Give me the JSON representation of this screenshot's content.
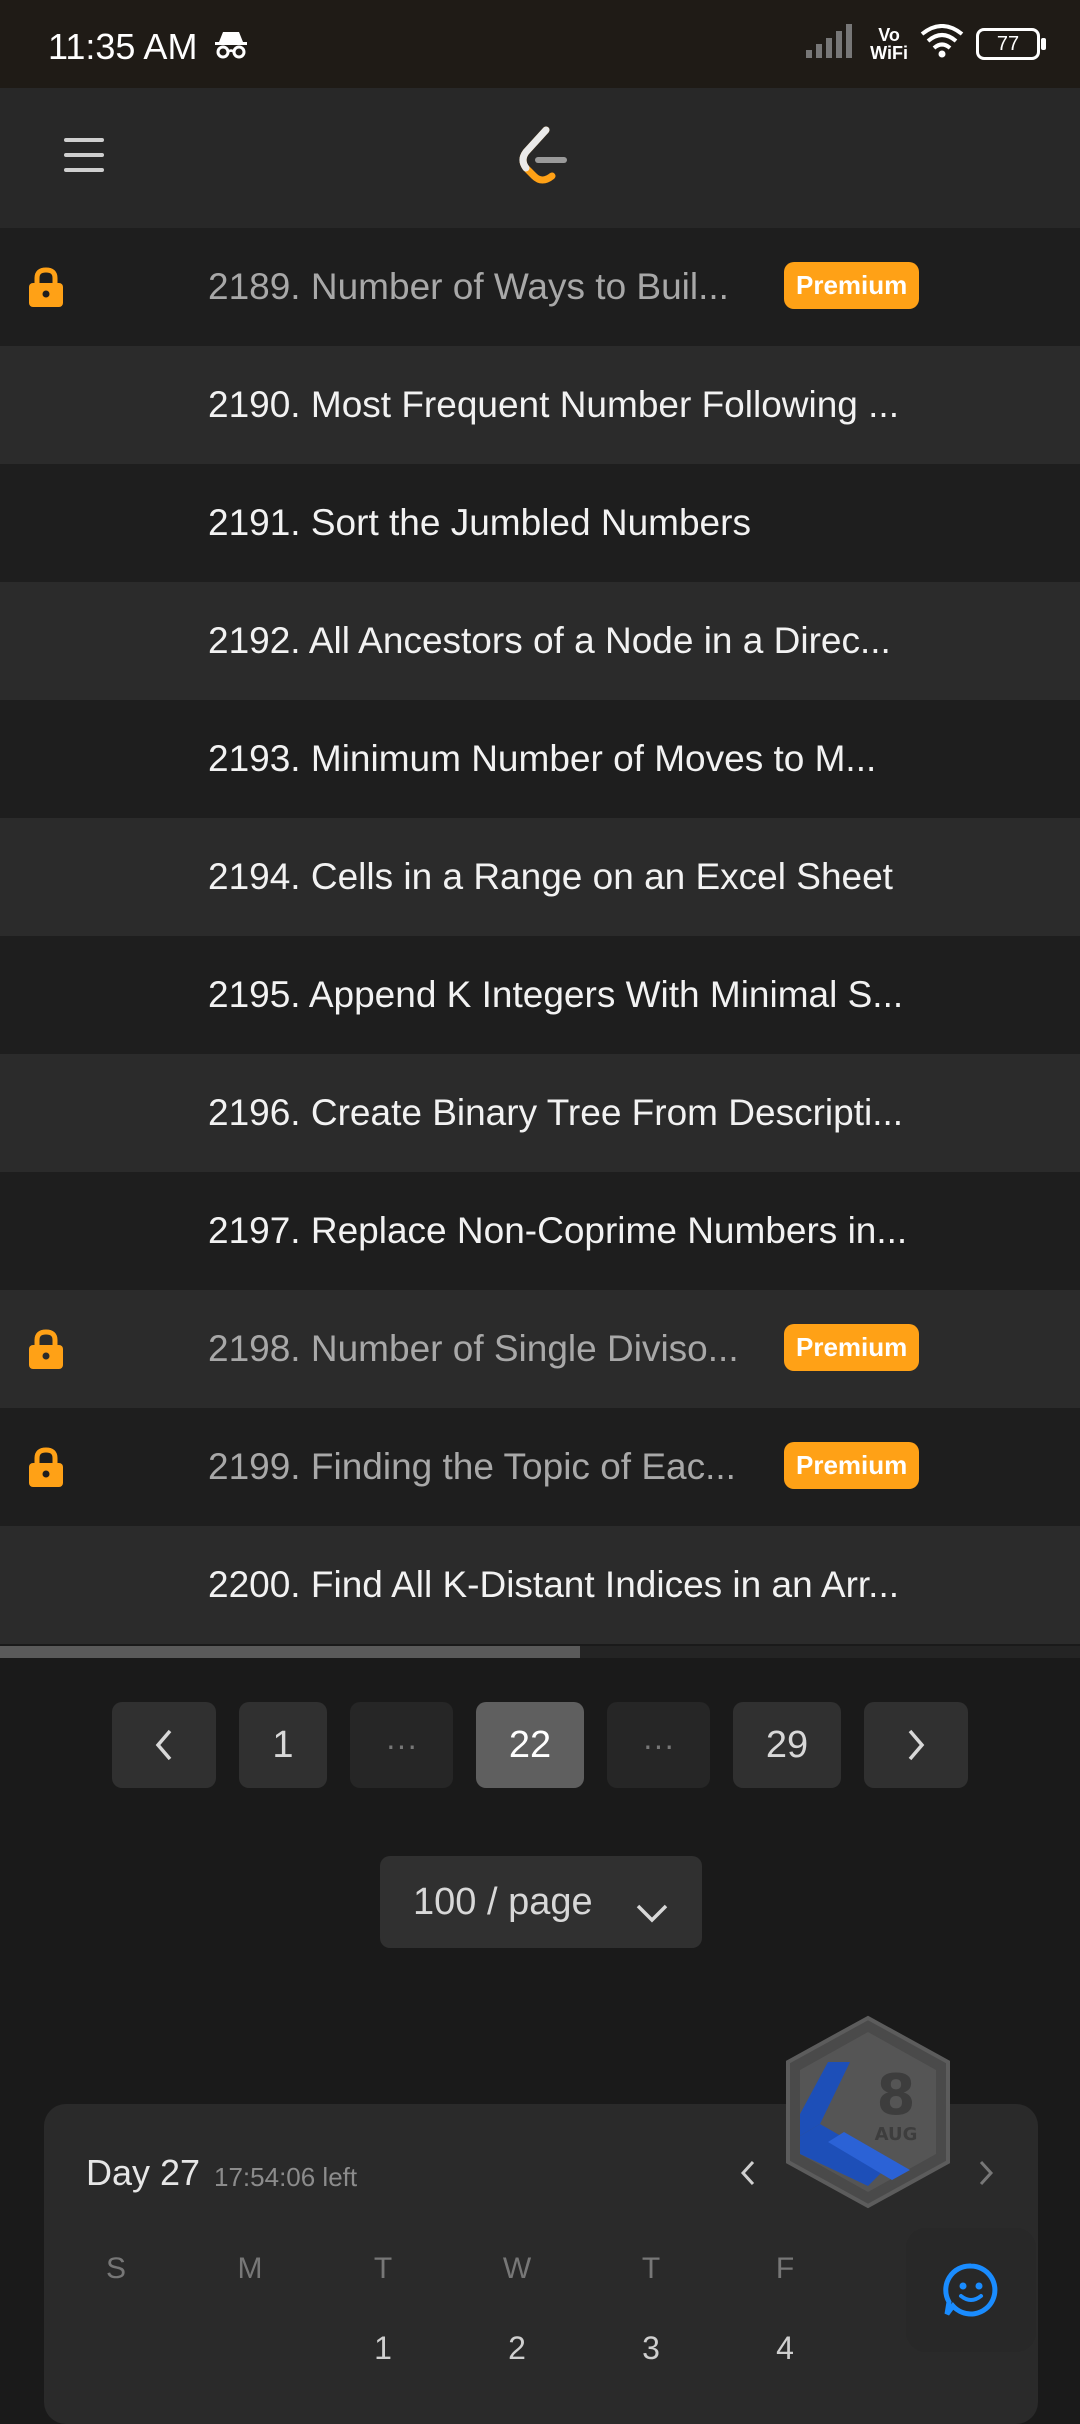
{
  "status": {
    "time": "11:35 AM",
    "vowifi_top": "Vo",
    "vowifi_bottom": "WiFi",
    "battery": "77"
  },
  "problems": [
    {
      "title": "2189. Number of Ways to Buil...",
      "locked": true,
      "badge": "Premium"
    },
    {
      "title": "2190. Most Frequent Number Following ...",
      "locked": false
    },
    {
      "title": "2191. Sort the Jumbled Numbers",
      "locked": false
    },
    {
      "title": "2192. All Ancestors of a Node in a Direc...",
      "locked": false
    },
    {
      "title": "2193. Minimum Number of Moves to M...",
      "locked": false
    },
    {
      "title": "2194. Cells in a Range on an Excel Sheet",
      "locked": false
    },
    {
      "title": "2195. Append K Integers With Minimal S...",
      "locked": false
    },
    {
      "title": "2196. Create Binary Tree From Descripti...",
      "locked": false
    },
    {
      "title": "2197. Replace Non-Coprime Numbers in...",
      "locked": false
    },
    {
      "title": "2198. Number of Single Diviso...",
      "locked": true,
      "badge": "Premium"
    },
    {
      "title": "2199. Finding the Topic of Eac...",
      "locked": true,
      "badge": "Premium"
    },
    {
      "title": "2200. Find All K-Distant Indices in an Arr...",
      "locked": false
    }
  ],
  "pagination": {
    "first": "1",
    "ellipsis": "···",
    "current": "22",
    "last": "29"
  },
  "page_size": "100 / page",
  "calendar": {
    "day": "Day 27",
    "time_left": "17:54:06 left",
    "badge_day": "8",
    "badge_month": "AUG",
    "weekdays": [
      "S",
      "M",
      "T",
      "W",
      "T",
      "F"
    ],
    "dates": [
      "1",
      "2",
      "3",
      "4"
    ]
  },
  "colors": {
    "accent": "#ffa116",
    "chat_icon": "#1a8cff",
    "badge_blue": "#1d4fb8"
  }
}
